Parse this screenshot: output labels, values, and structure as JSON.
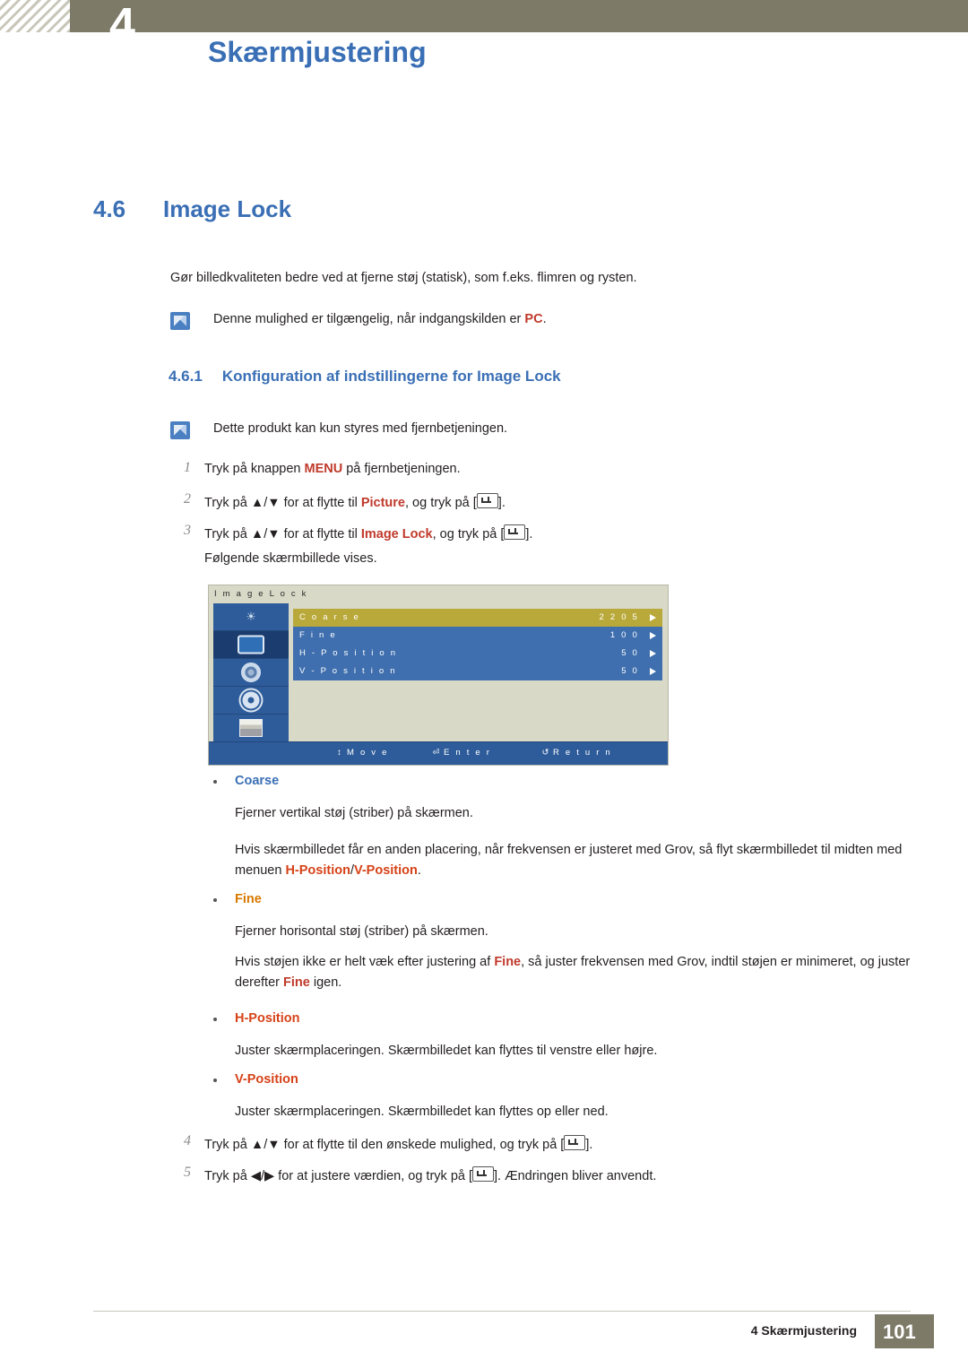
{
  "header": {
    "chapter_number": "4",
    "chapter_title": "Skærmjustering"
  },
  "section": {
    "number": "4.6",
    "title": "Image Lock"
  },
  "intro_paragraph": "Gør billedkvaliteten bedre ved at fjerne støj (statisk), som f.eks. flimren og rysten.",
  "note1": {
    "text_before": "Denne mulighed er tilgængelig, når indgangskilden er ",
    "highlight": "PC",
    "text_after": "."
  },
  "subsection": {
    "number": "4.6.1",
    "title": "Konfiguration af indstillingerne for Image Lock"
  },
  "note2": {
    "text": "Dette produkt kan kun styres med fjernbetjeningen."
  },
  "steps": {
    "s1_num": "1",
    "s1_a": "Tryk på knappen ",
    "s1_b": "MENU",
    "s1_c": " på fjernbetjeningen.",
    "s2_num": "2",
    "s2_a": "Tryk på ",
    "s2_arrows": "▲/▼",
    "s2_b": " for at flytte til ",
    "s2_c": "Picture",
    "s2_d": ", og tryk på [",
    "s2_e": "].",
    "s3_num": "3",
    "s3_a": "Tryk på ",
    "s3_arrows": "▲/▼",
    "s3_b": " for at flytte til ",
    "s3_c": "Image Lock",
    "s3_d": ", og tryk på [",
    "s3_e": "].",
    "s3_follow": "Følgende skærmbillede vises.",
    "s4_num": "4",
    "s4_a": "Tryk på ",
    "s4_arrows": "▲/▼",
    "s4_b": " for at flytte til den ønskede mulighed, og tryk på [",
    "s4_c": "].",
    "s5_num": "5",
    "s5_a": "Tryk på ",
    "s5_arrows": "◀/▶",
    "s5_b": " for at justere værdien, og tryk på [",
    "s5_c": "]. Ændringen bliver anvendt."
  },
  "osd": {
    "title": "I m a g e   L o c k",
    "icons": [
      {
        "name": "brightness-icon"
      },
      {
        "name": "picture-icon"
      },
      {
        "name": "sound-icon"
      },
      {
        "name": "setup-icon"
      },
      {
        "name": "multicontrol-icon"
      }
    ],
    "rows": [
      {
        "label": "C o a r s e",
        "value": "2 2 0 5",
        "highlight": true
      },
      {
        "label": "F i n e",
        "value": "1 0 0",
        "highlight": false
      },
      {
        "label": "H - P o s i t i o n",
        "value": "5 0",
        "highlight": false
      },
      {
        "label": "V - P o s i t i o n",
        "value": "5 0",
        "highlight": false
      }
    ],
    "footer": {
      "move": "M o v e",
      "enter": "E n t e r",
      "return": "R e t u r n"
    }
  },
  "bullets": {
    "coarse": {
      "label": "Coarse",
      "p1": "Fjerner vertikal støj (striber) på skærmen.",
      "p2_a": "Hvis skærmbilledet får en anden placering, når frekvensen er justeret med Grov, så flyt skærmbilledet til midten med menuen ",
      "p2_b": "H-Position",
      "p2_c": "/",
      "p2_d": "V-Position",
      "p2_e": "."
    },
    "fine": {
      "label": "Fine",
      "p1": "Fjerner horisontal støj (striber) på skærmen.",
      "p2_a": "Hvis støjen ikke er helt væk efter justering af ",
      "p2_b": "Fine",
      "p2_c": ", så juster frekvensen med Grov, indtil støjen er minimeret, og juster derefter ",
      "p2_d": "Fine",
      "p2_e": " igen."
    },
    "hposition": {
      "label": "H-Position",
      "p1": "Juster skærmplaceringen. Skærmbilledet kan flyttes til venstre eller højre."
    },
    "vposition": {
      "label": "V-Position",
      "p1": "Juster skærmplaceringen. Skærmbilledet kan flyttes op eller ned."
    }
  },
  "footer": {
    "text": "4 Skærmjustering",
    "page": "101"
  }
}
